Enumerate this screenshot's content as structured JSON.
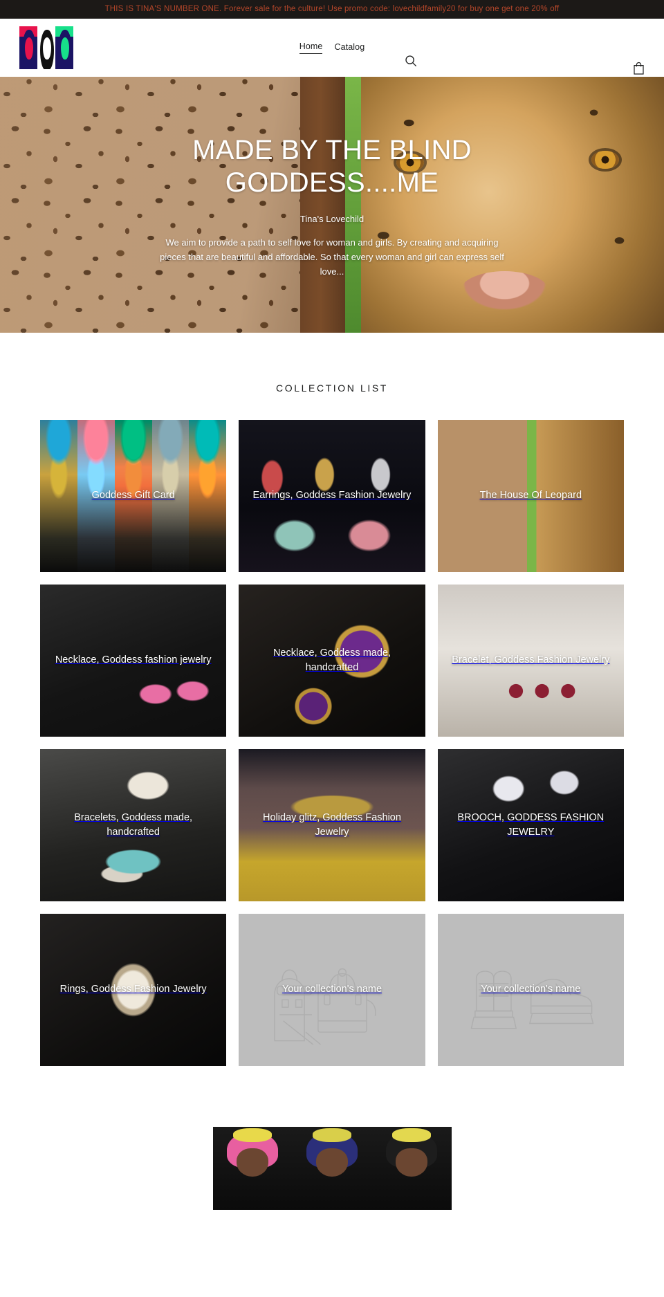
{
  "announcement": {
    "text": "THIS IS TINA'S NUMBER ONE. Forever sale for the culture! Use promo code: lovechildfamily20 for buy one get one 20% off",
    "color": "#b4462a",
    "background": "#1c1917"
  },
  "header": {
    "logo_name": "tinas-lovechild-logo",
    "nav": [
      {
        "label": "Home",
        "active": true
      },
      {
        "label": "Catalog",
        "active": false
      }
    ],
    "search_icon": "search-icon",
    "cart_icon": "shopping-bag-icon"
  },
  "hero": {
    "title": "MADE BY THE BLIND GODDESS....ME",
    "subtitle": "Tina's Lovechild",
    "description": "We aim to provide a path to self love for woman and girls. By creating and acquiring pieces that are beautiful and affordable.  So that every woman and girl can express self love..."
  },
  "collection_list": {
    "title": "COLLECTION LIST",
    "items": [
      {
        "label": "Goddess Gift Card",
        "art": "art-giftcard",
        "placeholder": false
      },
      {
        "label": "Earrings, Goddess Fashion Jewelry",
        "art": "art-earrings",
        "placeholder": false
      },
      {
        "label": "The House Of Leopard",
        "art": "art-leopard-top",
        "placeholder": false
      },
      {
        "label": "Necklace, Goddess fashion jewelry",
        "art": "art-necklace-butterfly",
        "placeholder": false
      },
      {
        "label": "Necklace, Goddess made, handcrafted",
        "art": "art-cameo",
        "placeholder": false
      },
      {
        "label": "Bracelet, Goddess Fashion Jewelry",
        "art": "art-bracelet-red",
        "placeholder": false
      },
      {
        "label": "Bracelets, Goddess made, handcrafted",
        "art": "art-bracelet-turq",
        "placeholder": false
      },
      {
        "label": "Holiday glitz, Goddess Fashion Jewelry",
        "art": "art-holiday",
        "placeholder": false
      },
      {
        "label": "BROOCH, GODDESS FASHION JEWELRY",
        "art": "art-brooch",
        "placeholder": false
      },
      {
        "label": "Rings, Goddess Fashion Jewelry",
        "art": "art-ring",
        "placeholder": false
      },
      {
        "label": "Your collection's name",
        "art": "art-placeholder",
        "placeholder": true,
        "placeholder_art": "bags-illustration"
      },
      {
        "label": "Your collection's name",
        "art": "art-placeholder",
        "placeholder": true,
        "placeholder_art": "shoes-illustration"
      }
    ]
  },
  "bottom_feature": {
    "image_name": "doll-triptych-image",
    "panels": 3
  }
}
